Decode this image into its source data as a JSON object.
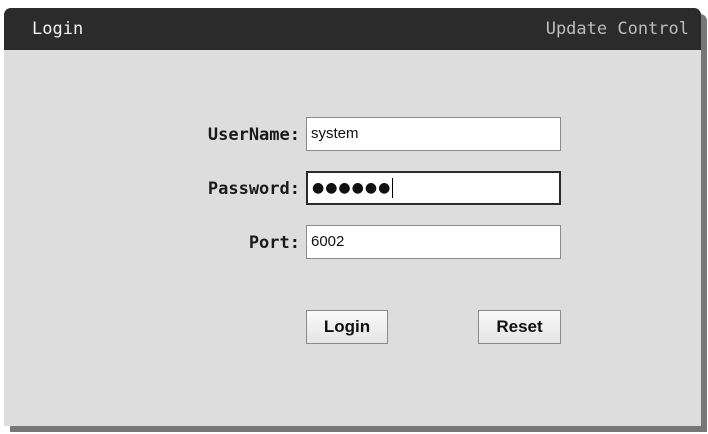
{
  "window": {
    "title": "Login",
    "subtitle": "Update Control"
  },
  "form": {
    "username_label": "UserName:",
    "username_value": "system",
    "password_label": "Password:",
    "password_value": "●●●●●●",
    "port_label": "Port:",
    "port_value": "6002"
  },
  "buttons": {
    "login_label": "Login",
    "reset_label": "Reset"
  }
}
